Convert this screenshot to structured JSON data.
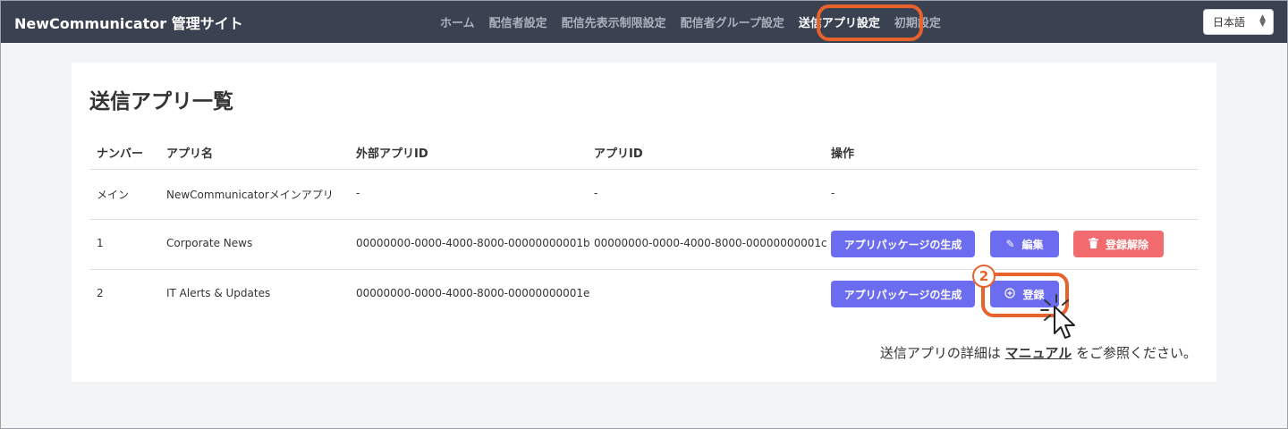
{
  "navbar": {
    "brand": "NewCommunicator 管理サイト",
    "items": [
      {
        "label": "ホーム",
        "active": false
      },
      {
        "label": "配信者設定",
        "active": false
      },
      {
        "label": "配信先表示制限設定",
        "active": false
      },
      {
        "label": "配信者グループ設定",
        "active": false
      },
      {
        "label": "送信アプリ設定",
        "active": true
      },
      {
        "label": "初期設定",
        "active": false
      }
    ],
    "language": "日本語"
  },
  "page": {
    "title": "送信アプリ一覧"
  },
  "table": {
    "headers": [
      "ナンバー",
      "アプリ名",
      "外部アプリID",
      "アプリID",
      "操作"
    ],
    "rows": [
      {
        "number": "メイン",
        "name": "NewCommunicatorメインアプリ",
        "external_id": "-",
        "app_id": "-",
        "actions_text": "-"
      },
      {
        "number": "1",
        "name": "Corporate News",
        "external_id": "00000000-0000-4000-8000-00000000001b",
        "app_id": "00000000-0000-4000-8000-00000000001c",
        "actions": [
          "アプリパッケージの生成",
          "編集",
          "登録解除"
        ]
      },
      {
        "number": "2",
        "name": "IT Alerts & Updates",
        "external_id": "00000000-0000-4000-8000-00000000001e",
        "app_id": "",
        "actions": [
          "アプリパッケージの生成",
          "登録"
        ]
      }
    ]
  },
  "footer": {
    "prefix": "送信アプリの詳細は",
    "link": "マニュアル",
    "suffix": "をご参照ください。"
  },
  "annotation": {
    "step": "2"
  },
  "colors": {
    "navbar_bg": "#3a4150",
    "primary_button": "#6c6cf0",
    "danger_button": "#f16b6f",
    "highlight": "#e8622c"
  }
}
